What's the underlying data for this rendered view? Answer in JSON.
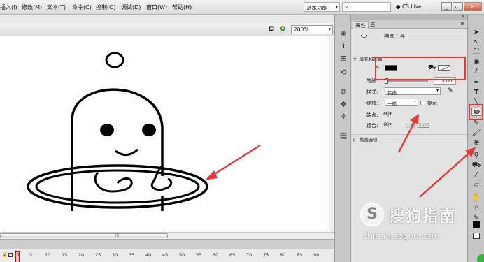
{
  "menu": {
    "items": [
      "插入(I)",
      "修改(M)",
      "文本(T)",
      "命令(C)",
      "控制(O)",
      "调试(D)",
      "窗口(W)",
      "帮助(H)"
    ],
    "workspace": "基本功能",
    "cs_live": "CS Live",
    "minimize": "_",
    "restore": "▭",
    "close": "✕"
  },
  "stage": {
    "zoom": "200%"
  },
  "timeline": {
    "frames": [
      "1",
      "5",
      "10",
      "15",
      "20",
      "25",
      "30",
      "35",
      "40",
      "45",
      "50",
      "55",
      "60",
      "65",
      "70",
      "75",
      "80",
      "85",
      "90"
    ]
  },
  "properties": {
    "tab_properties": "属性",
    "tab_library": "库",
    "tool_name": "椭圆工具",
    "fill_stroke_section": "填充和笔触",
    "stroke_label": "笔触:",
    "stroke_value": "3.00",
    "style_label": "样式:",
    "style_value": "实线",
    "scale_label": "缩放:",
    "scale_value": "一般",
    "hint_label": "提示",
    "cap_label": "端点:",
    "join_label": "接合:",
    "miter_label": "尖角:",
    "miter_value": "3.00",
    "oval_options_section": "椭圆选项",
    "stroke_color": "#000000",
    "fill_color": "none"
  },
  "tools": {
    "icons": [
      "selection-arrow-icon",
      "subselection-icon",
      "free-transform-icon",
      "3d-rotation-icon",
      "lasso-icon",
      "pen-icon",
      "text-icon",
      "line-icon",
      "oval-icon",
      "pencil-icon",
      "brush-icon",
      "deco-icon",
      "bone-icon",
      "paint-bucket-icon",
      "eyedropper-icon",
      "eraser-icon",
      "hand-icon",
      "zoom-icon",
      "stroke-color-icon",
      "fill-color-icon"
    ]
  },
  "watermark": {
    "logo": "S",
    "title": "搜狗指南",
    "url": "zhinan.sogou.com"
  },
  "colors": {
    "annotation": "#e23a3a",
    "stage": "#ffffff",
    "panel": "#e3e3e3"
  }
}
